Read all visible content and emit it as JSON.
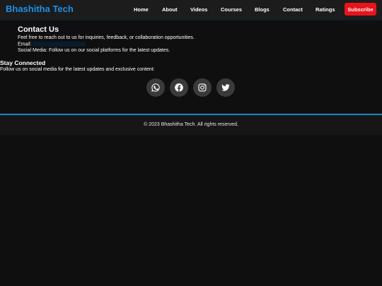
{
  "header": {
    "brand": "Bhashitha Tech",
    "nav": [
      "Home",
      "About",
      "Videos",
      "Courses",
      "Blogs",
      "Contact",
      "Ratings"
    ],
    "subscribe_label": "Subscribe",
    "brand_color": "#1e90e8",
    "subscribe_color": "#e8141a"
  },
  "contact": {
    "title": "Contact Us",
    "intro": "Feel free to reach out to us for inquiries, feedback, or collaboration opportunities.",
    "email_label": "Email:",
    "email_value": "",
    "social_text": "Social Media: Follow us on our social platforms for the latest updates."
  },
  "stay": {
    "title": "Stay Connected",
    "text": "Follow us on social media for the latest updates and exclusive content:"
  },
  "social_icons": [
    "whatsapp-icon",
    "facebook-icon",
    "instagram-icon",
    "twitter-icon"
  ],
  "footer": {
    "copyright": "© 2023 Bhashitha Tech. All rights reserved.",
    "accent_color": "#1d86c8"
  }
}
